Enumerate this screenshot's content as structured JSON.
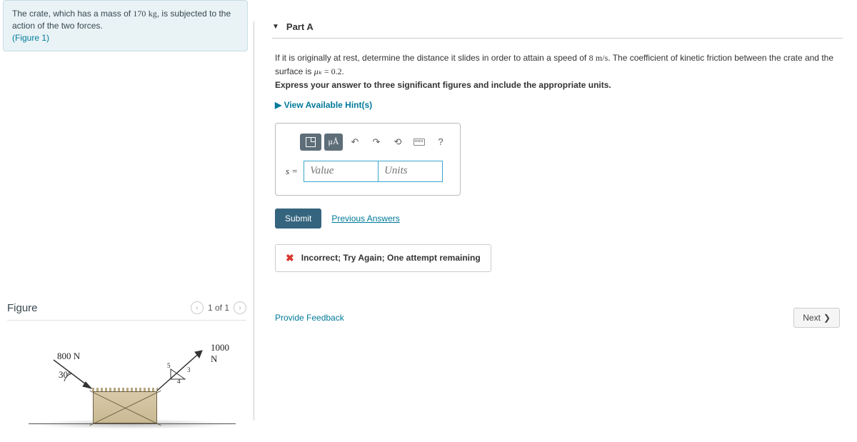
{
  "problem": {
    "text_pre": "The crate, which has a mass of ",
    "mass": "170",
    "mass_unit": "kg",
    "text_post": ", is subjected to the action of the two forces.",
    "figure_ref": "(Figure 1)"
  },
  "figure": {
    "title": "Figure",
    "pager": "1 of 1",
    "force_left": "800 N",
    "angle_left": "30°",
    "force_right": "1000 N",
    "tri_a": "5",
    "tri_b": "3",
    "tri_c": "4"
  },
  "part": {
    "label": "Part A",
    "q1": "If it is originally at rest, determine the distance it slides in order to attain a speed of ",
    "speed": "8",
    "speed_unit": "m/s",
    "q2": ". The coefficient of kinetic friction between the crate and the surface is ",
    "mu_sym": "μₖ",
    "mu_val": " = 0.2.",
    "instruct": "Express your answer to three significant figures and include the appropriate units.",
    "hints": "View Available Hint(s)"
  },
  "toolbar": {
    "units_label": "μÅ"
  },
  "input": {
    "var": "s =",
    "value_ph": "Value",
    "units_ph": "Units"
  },
  "actions": {
    "submit": "Submit",
    "previous": "Previous Answers"
  },
  "feedback": {
    "msg": "Incorrect; Try Again; One attempt remaining"
  },
  "footer": {
    "provide": "Provide Feedback",
    "next": "Next"
  }
}
